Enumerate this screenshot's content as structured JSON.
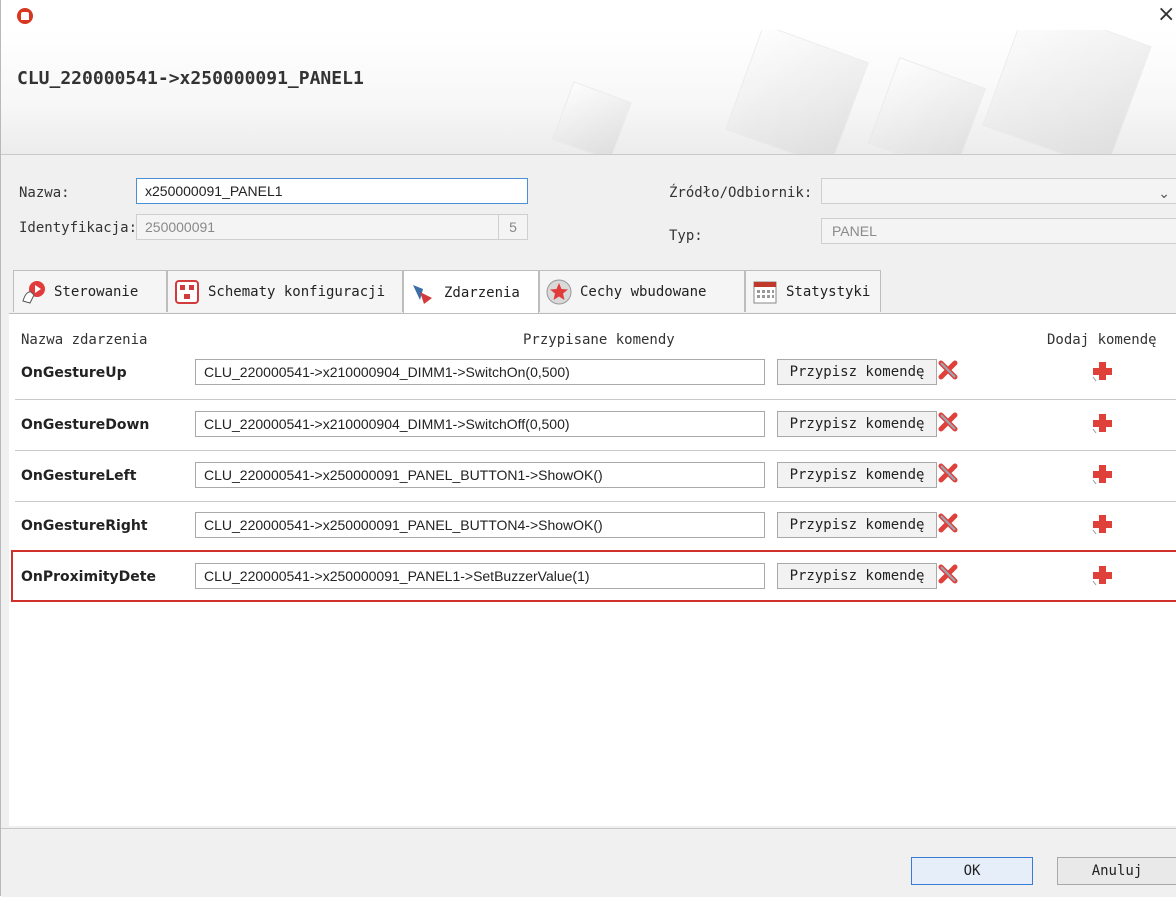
{
  "window": {
    "title": "CLU_220000541->x250000091_PANEL1",
    "close_glyph": "×"
  },
  "form": {
    "name_label": "Nazwa:",
    "name_value": "x250000091_PANEL1",
    "id_label": "Identyfikacja:",
    "id_value": "250000091",
    "id_suffix": "5",
    "source_label": "Źródło/Odbiornik:",
    "source_value": "",
    "type_label": "Typ:",
    "type_value": "PANEL"
  },
  "tabs": [
    {
      "label": "Sterowanie",
      "icon": "hand-touch-icon",
      "active": false
    },
    {
      "label": "Schematy konfiguracji",
      "icon": "schema-icon",
      "active": false
    },
    {
      "label": "Zdarzenia",
      "icon": "events-icon",
      "active": true
    },
    {
      "label": "Cechy wbudowane",
      "icon": "star-icon",
      "active": false
    },
    {
      "label": "Statystyki",
      "icon": "calendar-icon",
      "active": false
    }
  ],
  "table": {
    "headers": {
      "event": "Nazwa zdarzenia",
      "commands": "Przypisane komendy",
      "add": "Dodaj komendę"
    },
    "rows": [
      {
        "event": "OnGestureUp",
        "command": "CLU_220000541->x210000904_DIMM1->SwitchOn(0,500)",
        "assign": "Przypisz komendę"
      },
      {
        "event": "OnGestureDown",
        "command": "CLU_220000541->x210000904_DIMM1->SwitchOff(0,500)",
        "assign": "Przypisz komendę"
      },
      {
        "event": "OnGestureLeft",
        "command": "CLU_220000541->x250000091_PANEL_BUTTON1->ShowOK()",
        "assign": "Przypisz komendę"
      },
      {
        "event": "OnGestureRight",
        "command": "CLU_220000541->x250000091_PANEL_BUTTON4->ShowOK()",
        "assign": "Przypisz komendę"
      },
      {
        "event": "OnProximityDete",
        "command": "CLU_220000541->x250000091_PANEL1->SetBuzzerValue(1)",
        "assign": "Przypisz komendę"
      }
    ]
  },
  "footer": {
    "ok_label": "OK",
    "cancel_label": "Anuluj"
  },
  "colors": {
    "accent_red": "#d0312d",
    "focus_blue": "#4a8fd6"
  }
}
